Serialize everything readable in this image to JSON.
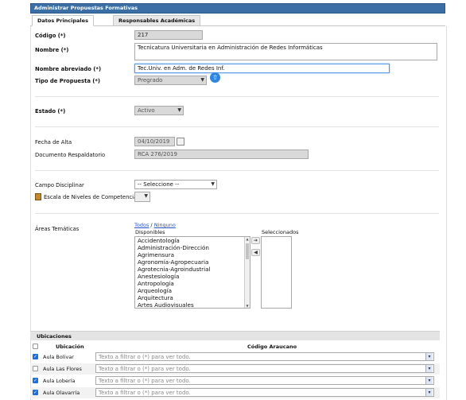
{
  "window": {
    "title": "Administrar Propuestas Formativas"
  },
  "tabs": [
    {
      "label": "Datos Principales"
    },
    {
      "label": "Responsables Académicas"
    }
  ],
  "form": {
    "codigo": {
      "label": "Código (*)",
      "value": "217"
    },
    "nombre": {
      "label": "Nombre (*)",
      "value": "Tecnicatura Universitaria en Administración de Redes Informáticas"
    },
    "nombre_abreviado": {
      "label": "Nombre abreviado (*)",
      "value": "Tec.Univ. en Adm. de Redes Inf."
    },
    "tipo_propuesta": {
      "label": "Tipo de Propuesta (*)",
      "value": "Pregrado"
    },
    "estado": {
      "label": "Estado (*)",
      "value": "Activo"
    },
    "fecha_alta": {
      "label": "Fecha de Alta",
      "value": "04/10/2019"
    },
    "documento": {
      "label": "Documento Respaldatorio",
      "value": "RCA 276/2019"
    },
    "campo_disciplinar": {
      "label": "Campo Disciplinar",
      "value": "-- Seleccione --"
    },
    "escala": {
      "label": "Escala de Niveles de Competencias",
      "value": ""
    },
    "areas": {
      "label": "Áreas Temáticas",
      "todos": "Todos",
      "sep": "/",
      "ninguno": "Ninguno",
      "disponibles_label": "Disponibles",
      "seleccionados_label": "Seleccionados",
      "disponibles": [
        "Accidentología",
        "Administración-Dirección",
        "Agrimensura",
        "Agronomía-Agropecuaria",
        "Agrotecnia-Agroindustrial",
        "Anestesiología",
        "Antropología",
        "Arqueología",
        "Arquitectura",
        "Artes Audiovisuales"
      ],
      "add_arrow": "➔",
      "remove_arrow": "◀"
    }
  },
  "ubicaciones": {
    "title": "Ubicaciones",
    "col_ubicacion": "Ubicación",
    "col_codigo": "Código Araucano",
    "placeholder": "Texto a filtrar o (*) para ver todo.",
    "rows": [
      {
        "name": "Aula Bolivar",
        "checked": true
      },
      {
        "name": "Aula Las Flores",
        "checked": false
      },
      {
        "name": "Aula Lobería",
        "checked": true
      },
      {
        "name": "Aula Olavarría",
        "checked": true
      }
    ]
  },
  "icons": {
    "help": "arrow-up-circle-icon",
    "calendar": "calendar-icon",
    "leaf": "edit-icon"
  },
  "colors": {
    "titlebar": "#3a6ea5",
    "accent": "#2f86e0",
    "checkbox": "#1f6fd6"
  }
}
